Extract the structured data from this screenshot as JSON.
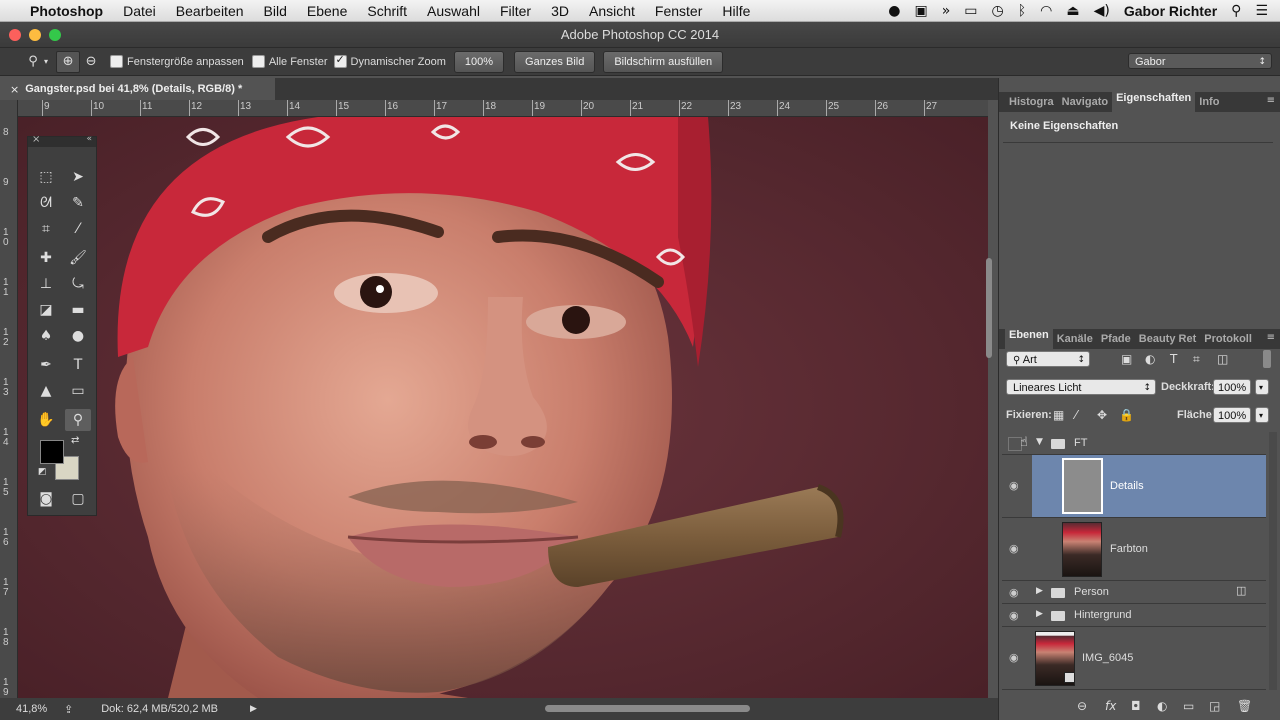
{
  "menubar": {
    "apple": "",
    "items": [
      "Photoshop",
      "Datei",
      "Bearbeiten",
      "Bild",
      "Ebene",
      "Schrift",
      "Auswahl",
      "Filter",
      "3D",
      "Ansicht",
      "Fenster",
      "Hilfe"
    ],
    "user": "Gabor Richter"
  },
  "window": {
    "title": "Adobe Photoshop CC 2014"
  },
  "options": {
    "fit_window": "Fenstergröße anpassen",
    "all_windows": "Alle Fenster",
    "scrubby_zoom": "Dynamischer Zoom",
    "btn_100": "100%",
    "btn_fit": "Ganzes Bild",
    "btn_fill": "Bildschirm ausfüllen",
    "workspace": "Gabor"
  },
  "document": {
    "tab_title": "Gangster.psd bei 41,8% (Details, RGB/8) *",
    "ruler_top": [
      "9",
      "10",
      "11",
      "12",
      "13",
      "14",
      "15",
      "16",
      "17",
      "18",
      "19",
      "20",
      "21",
      "22",
      "23",
      "24",
      "25",
      "26",
      "27"
    ],
    "ruler_left": [
      "8",
      "9",
      "1\n0",
      "1\n1",
      "1\n2",
      "1\n3",
      "1\n4",
      "1\n5",
      "1\n6",
      "1\n7",
      "1\n8",
      "1\n9"
    ]
  },
  "status": {
    "zoom": "41,8%",
    "doc": "Dok: 62,4 MB/520,2 MB"
  },
  "properties_panel": {
    "tabs": [
      "Histogra",
      "Navigato",
      "Eigenschaften",
      "Info"
    ],
    "active_tab": 2,
    "content": "Keine Eigenschaften"
  },
  "layers_panel": {
    "tabs": [
      "Ebenen",
      "Kanäle",
      "Pfade",
      "Beauty Ret",
      "Protokoll"
    ],
    "active_tab": 0,
    "filter": "Art",
    "blend_mode": "Lineares Licht",
    "opacity_label": "Deckkraft:",
    "opacity": "100%",
    "lock_label": "Fixieren:",
    "fill_label": "Fläche:",
    "fill": "100%",
    "layers": [
      {
        "name": "FT",
        "kind": "group-open",
        "visible": false
      },
      {
        "name": "Details",
        "kind": "layer",
        "selected": true
      },
      {
        "name": "Farbton",
        "kind": "layer"
      },
      {
        "name": "Person",
        "kind": "group-closed",
        "visible": true
      },
      {
        "name": "Hintergrund",
        "kind": "group-closed",
        "visible": true
      },
      {
        "name": "IMG_6045",
        "kind": "smart-object",
        "visible": true
      }
    ]
  },
  "colors": {
    "foreground": "#000000",
    "background": "#d9d6c4",
    "selection": "#6d86ad",
    "canvas_bg": "#5a2a32"
  }
}
